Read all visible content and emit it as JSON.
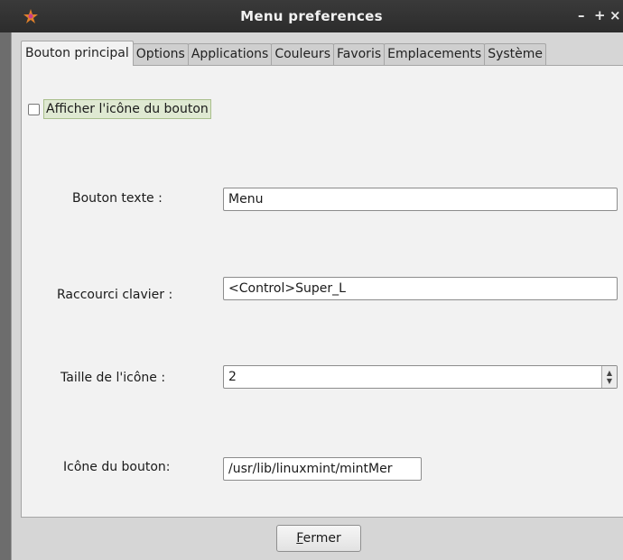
{
  "window": {
    "title": "Menu preferences",
    "controls": {
      "minimize": "–",
      "maximize": "+",
      "close": "×"
    }
  },
  "tabs": [
    {
      "label": "Bouton principal",
      "active": true
    },
    {
      "label": "Options",
      "active": false
    },
    {
      "label": "Applications",
      "active": false
    },
    {
      "label": "Couleurs",
      "active": false
    },
    {
      "label": "Favoris",
      "active": false
    },
    {
      "label": "Emplacements",
      "active": false
    },
    {
      "label": "Système",
      "active": false
    }
  ],
  "main_button": {
    "show_icon": {
      "label": "Afficher l'icône du bouton",
      "checked": false
    },
    "button_text": {
      "label": "Bouton texte :",
      "value": "Menu"
    },
    "keyboard_shortcut": {
      "label": "Raccourci clavier :",
      "value": "<Control>Super_L"
    },
    "icon_size": {
      "label": "Taille de l'icône :",
      "value": "2"
    },
    "button_icon": {
      "label": "Icône du bouton:",
      "value": "/usr/lib/linuxmint/mintMer"
    }
  },
  "footer": {
    "close_mnemonic": "F",
    "close_rest": "ermer"
  },
  "icons": {
    "app": "mint-menu-star-icon",
    "preview": "linux-mint-logo-icon",
    "cursor": "mouse-pointer-icon"
  },
  "colors": {
    "titlebar": "#2f2f2f",
    "mint_green": "#7dc242",
    "checkbox_highlight": "#dfe9d2"
  }
}
